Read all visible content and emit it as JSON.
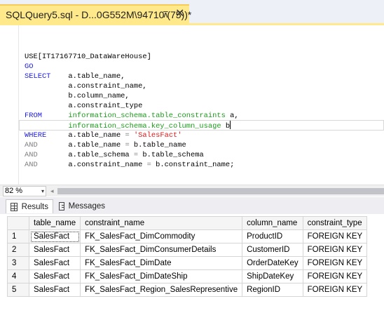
{
  "tab": {
    "title": "SQLQuery5.sql - D...0G552M\\94710 (75))*",
    "pin_glyph": "⊼",
    "close_glyph": "✕"
  },
  "editor": {
    "lines": [
      [
        {
          "t": "USE[IT17167710_DataWareHouse]",
          "c": ""
        }
      ],
      [
        {
          "t": "GO",
          "c": "kw"
        }
      ],
      [
        {
          "t": "SELECT",
          "c": "kw"
        },
        {
          "t": "    a.table_name,",
          "c": ""
        }
      ],
      [
        {
          "t": "          a.constraint_name,",
          "c": ""
        }
      ],
      [
        {
          "t": "          b.column_name,",
          "c": ""
        }
      ],
      [
        {
          "t": "          a.constraint_type",
          "c": ""
        }
      ],
      [
        {
          "t": "FROM",
          "c": "kw"
        },
        {
          "t": "      ",
          "c": ""
        },
        {
          "t": "information_schema.table_constraints",
          "c": "green"
        },
        {
          "t": " a,",
          "c": ""
        }
      ],
      [
        {
          "t": "          ",
          "c": ""
        },
        {
          "t": "information_schema.key_column_usage",
          "c": "green"
        },
        {
          "t": " b",
          "c": ""
        }
      ],
      [
        {
          "t": "WHERE",
          "c": "kw"
        },
        {
          "t": "     a.table_name ",
          "c": ""
        },
        {
          "t": "=",
          "c": "gray"
        },
        {
          "t": " ",
          "c": ""
        },
        {
          "t": "'SalesFact'",
          "c": "str"
        }
      ],
      [
        {
          "t": "AND",
          "c": "gray"
        },
        {
          "t": "       a.table_name ",
          "c": ""
        },
        {
          "t": "=",
          "c": "gray"
        },
        {
          "t": " b.table_name",
          "c": ""
        }
      ],
      [
        {
          "t": "AND",
          "c": "gray"
        },
        {
          "t": "       a.table_schema ",
          "c": ""
        },
        {
          "t": "=",
          "c": "gray"
        },
        {
          "t": " b.table_schema",
          "c": ""
        }
      ],
      [
        {
          "t": "AND",
          "c": "gray"
        },
        {
          "t": "       a.constraint_name ",
          "c": ""
        },
        {
          "t": "=",
          "c": "gray"
        },
        {
          "t": " b.constraint_name;",
          "c": ""
        }
      ]
    ]
  },
  "zoom": {
    "value": "82 %",
    "arrow": "▾",
    "scroll_left": "◂"
  },
  "results_tabs": [
    {
      "label": "Results",
      "icon": "grid-icon"
    },
    {
      "label": "Messages",
      "icon": "messages-icon"
    }
  ],
  "grid": {
    "headers": [
      "",
      "table_name",
      "constraint_name",
      "column_name",
      "constraint_type"
    ],
    "rows": [
      [
        "1",
        "SalesFact",
        "FK_SalesFact_DimCommodity",
        "ProductID",
        "FOREIGN KEY"
      ],
      [
        "2",
        "SalesFact",
        "FK_SalesFact_DimConsumerDetails",
        "CustomerID",
        "FOREIGN KEY"
      ],
      [
        "3",
        "SalesFact",
        "FK_SalesFact_DimDate",
        "OrderDateKey",
        "FOREIGN KEY"
      ],
      [
        "4",
        "SalesFact",
        "FK_SalesFact_DimDateShip",
        "ShipDateKey",
        "FOREIGN KEY"
      ],
      [
        "5",
        "SalesFact",
        "FK_SalesFact_Region_SalesRepresentive",
        "RegionID",
        "FOREIGN KEY"
      ]
    ]
  },
  "colors": {
    "tab_active": "#ffe98a",
    "keyword": "#1a1ae0",
    "object": "#1c9b1c",
    "string": "#e01515"
  }
}
